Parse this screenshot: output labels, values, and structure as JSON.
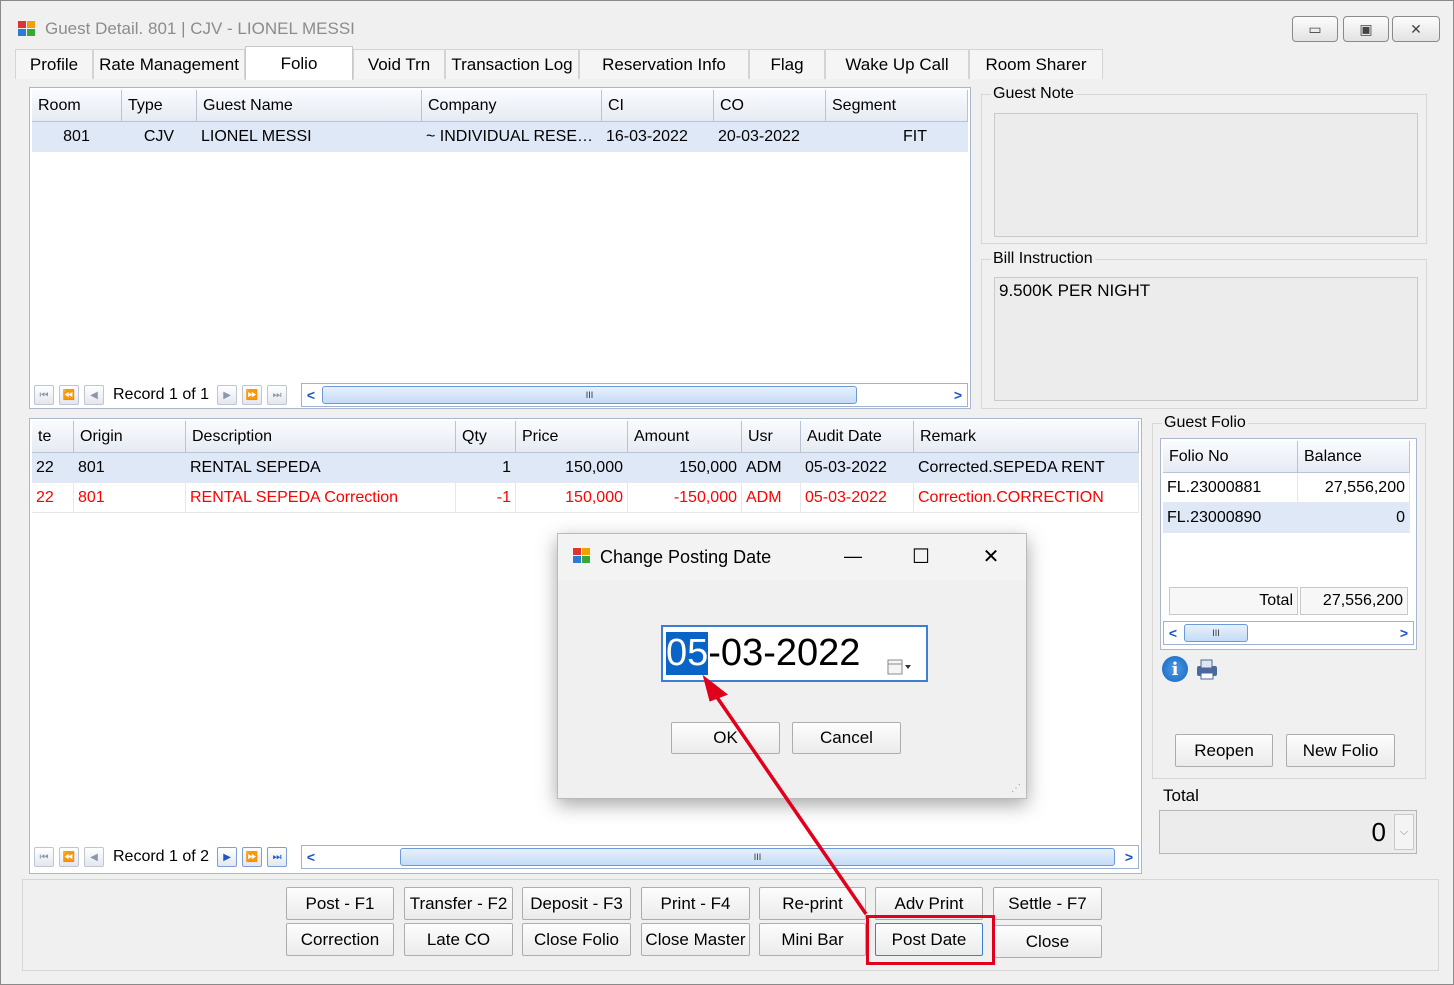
{
  "window": {
    "title": "Guest Detail. 801 | CJV - LIONEL MESSI",
    "min": "▭",
    "max": "▣",
    "close": "✕"
  },
  "tabs": [
    "Profile",
    "Rate Management",
    "Folio",
    "Void Trn",
    "Transaction Log",
    "Reservation Info",
    "Flag",
    "Wake Up Call",
    "Room Sharer"
  ],
  "guest_grid": {
    "headers": [
      "Room",
      "Type",
      "Guest Name",
      "Company",
      "CI",
      "CO",
      "Segment"
    ],
    "row": [
      "801",
      "CJV",
      "LIONEL MESSI",
      "~ INDIVIDUAL RESE…",
      "16-03-2022",
      "20-03-2022",
      "FIT"
    ],
    "record": "Record 1 of 1"
  },
  "guest_note": {
    "label": "Guest Note",
    "text": ""
  },
  "bill_instruction": {
    "label": "Bill Instruction",
    "text": "9.500K PER NIGHT"
  },
  "trans_grid": {
    "headers": [
      "te",
      "Origin",
      "Description",
      "Qty",
      "Price",
      "Amount",
      "Usr",
      "Audit Date",
      "Remark"
    ],
    "rows": [
      [
        "22",
        "801",
        "RENTAL SEPEDA",
        "1",
        "150,000",
        "150,000",
        "ADM",
        "05-03-2022",
        "Corrected.SEPEDA RENT"
      ],
      [
        "22",
        "801",
        "RENTAL SEPEDA Correction",
        "-1",
        "150,000",
        "-150,000",
        "ADM",
        "05-03-2022",
        "Correction.CORRECTION"
      ]
    ],
    "record": "Record 1 of 2"
  },
  "guest_folio": {
    "label": "Guest Folio",
    "headers": [
      "Folio No",
      "Balance"
    ],
    "rows": [
      [
        "FL.23000881",
        "27,556,200"
      ],
      [
        "FL.23000890",
        "0"
      ]
    ],
    "total_label": "Total",
    "total_value": "27,556,200",
    "reopen": "Reopen",
    "new_folio": "New Folio"
  },
  "total_box": {
    "label": "Total",
    "value": "0"
  },
  "buttons_row1": [
    "Post - F1",
    "Transfer - F2",
    "Deposit - F3",
    "Print - F4",
    "Re-print",
    "Adv Print",
    "Settle - F7"
  ],
  "buttons_row2": [
    "Correction",
    "Late CO",
    "Close Folio",
    "Close Master",
    "Mini Bar",
    "Post Date",
    "Close"
  ],
  "dialog": {
    "title": "Change Posting Date",
    "date_day": "05",
    "date_rest": "-03-2022",
    "ok": "OK",
    "cancel": "Cancel",
    "min": "—",
    "max": "☐",
    "close": "✕"
  },
  "colors": {
    "highlight": "#e0001b",
    "selection": "#0a64c8",
    "grid_selected": "#dfe8f6",
    "error_text": "#ff0000"
  }
}
